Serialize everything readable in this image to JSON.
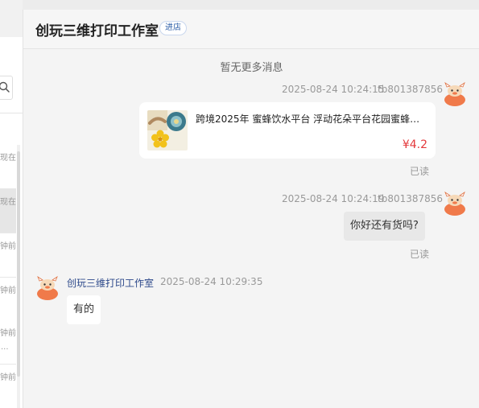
{
  "header": {
    "title": "创玩三维打印工作室",
    "enter_shop": "进店"
  },
  "sidebar": {
    "items": [
      {
        "time": "现在",
        "more": ""
      },
      {
        "time": "现在",
        "more": ""
      },
      {
        "time": "钟前",
        "more": ""
      },
      {
        "time": "钟前",
        "more": ""
      },
      {
        "time": "钟前",
        "more": "..."
      },
      {
        "time": "钟前",
        "more": ""
      }
    ]
  },
  "chat": {
    "no_more": "暂无更多消息",
    "messages": [
      {
        "kind": "product",
        "timestamp": "2025-08-24 10:24:15",
        "sender": "tb801387856",
        "product_title": "跨境2025年 蜜蜂饮水平台 浮动花朵平台花园蜜蜂昆...",
        "price": "¥4.2",
        "status": "已读"
      },
      {
        "kind": "text",
        "timestamp": "2025-08-24 10:24:19",
        "sender": "tb801387856",
        "text": "你好还有货吗?",
        "status": "已读"
      },
      {
        "kind": "text",
        "timestamp": "2025-08-24 10:29:35",
        "sender": "创玩三维打印工作室",
        "text": "有的"
      }
    ]
  },
  "colors": {
    "price": "#e4393c",
    "sender_name": "#2e4a8b",
    "avatar": "#f07a4a"
  }
}
